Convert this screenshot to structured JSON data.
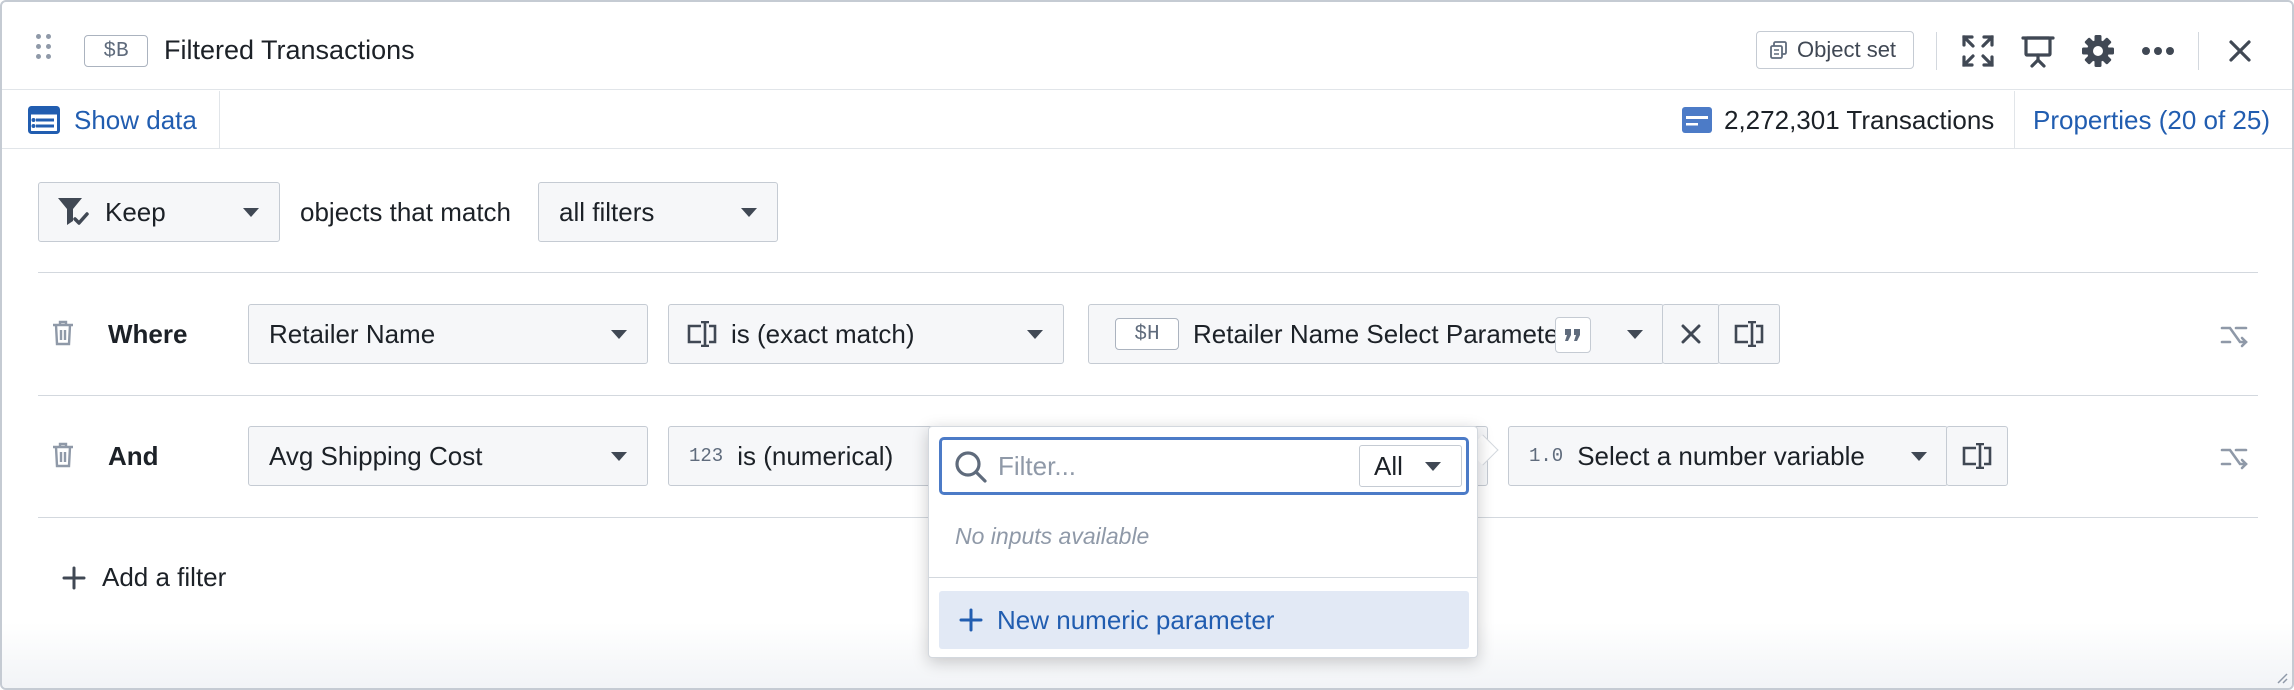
{
  "header": {
    "tag": "$B",
    "title": "Filtered Transactions",
    "object_set_label": "Object set",
    "icons": [
      "drag-handle-icon",
      "fullscreen-icon",
      "presentation-icon",
      "gear-icon",
      "more-icon",
      "close-icon"
    ]
  },
  "subheader": {
    "show_data_label": "Show data",
    "count_label": "2,272,301 Transactions",
    "properties_label": "Properties (20 of 25)"
  },
  "top_filter": {
    "keep_label": "Keep",
    "match_text": "objects that match",
    "match_mode": "all filters"
  },
  "filters": [
    {
      "conjunction": "Where",
      "property": "Retailer Name",
      "operator": "is (exact match)",
      "value_tag": "$H",
      "value_label": "Retailer Name Select Parameter"
    },
    {
      "conjunction": "And",
      "property": "Avg Shipping Cost",
      "operator_prefix": "123",
      "operator": "is (numerical)",
      "value_prefix": "1.0",
      "value_label": "Select a number variable"
    }
  ],
  "add_filter_label": "Add a filter",
  "popover": {
    "filter_placeholder": "Filter...",
    "scope_label": "All",
    "empty_text": "No inputs available",
    "new_param_label": "New numeric parameter"
  },
  "colors": {
    "accent": "#215db0",
    "highlight": "#e2e9f5",
    "focus_border": "#4c7bc7"
  }
}
